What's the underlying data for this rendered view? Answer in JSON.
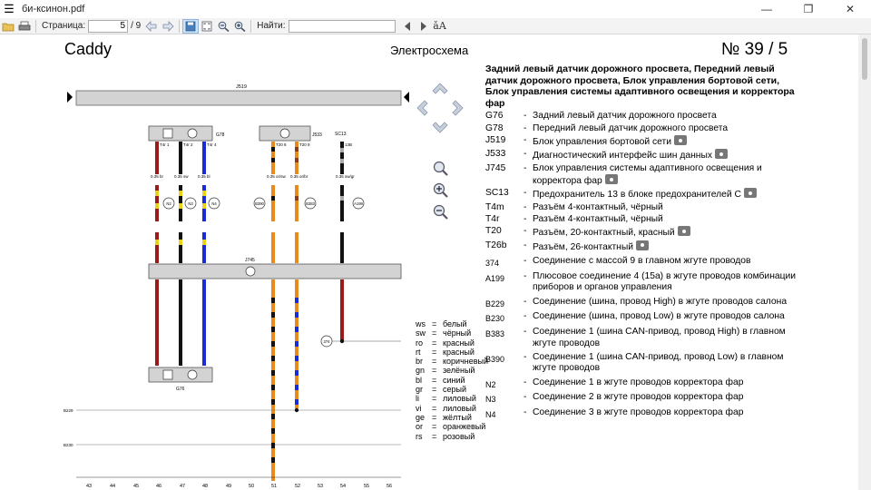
{
  "window": {
    "title": "би-ксинон.pdf",
    "buttons": [
      "—",
      "❐",
      "✕"
    ]
  },
  "toolbar": {
    "page_label": "Страница:",
    "page_value": "5",
    "page_total": "/ 9",
    "find_label": "Найти:",
    "find_value": ""
  },
  "doc": {
    "model": "Caddy",
    "section": "Электросхема",
    "number": "№  39 / 5"
  },
  "legend": {
    "heading": "Задний левый датчик дорожного просвета, Передний левый датчик дорожного просвета, Блок управления бортовой сети, Блок управления системы адаптивного освещения и корректора фар",
    "items": [
      {
        "code": "G76",
        "desc": "Задний левый датчик дорожного просвета",
        "cam": false
      },
      {
        "code": "G78",
        "desc": "Передний левый датчик дорожного просвета",
        "cam": false
      },
      {
        "code": "J519",
        "desc": "Блок управления бортовой сети",
        "cam": true
      },
      {
        "code": "J533",
        "desc": "Диагностический интерфейс шин данных",
        "cam": true
      },
      {
        "code": "J745",
        "desc": "Блок управления системы адаптивного освещения и корректора фар",
        "cam": true
      },
      {
        "code": "SC13",
        "desc": "Предохранитель 13 в блоке предохранителей С",
        "cam": true
      },
      {
        "code": "T4m",
        "desc": "Разъём 4-контактный, чёрный",
        "cam": false
      },
      {
        "code": "T4r",
        "desc": "Разъём 4-контактный, чёрный",
        "cam": false
      },
      {
        "code": "T20",
        "desc": "Разъём, 20-контактный, красный",
        "cam": true
      },
      {
        "code": "T26b",
        "desc": "Разъём, 26-контактный",
        "cam": true
      },
      {
        "code": "374",
        "desc": "Соединение с массой 9 в главном жгуте проводов",
        "cam": false
      },
      {
        "code": "A199",
        "desc": "Плюсовое соединение 4 (15a) в жгуте проводов комбинации приборов и органов управления",
        "cam": false
      },
      {
        "code": "B229",
        "desc": "Соединение (шина, провод High) в жгуте проводов салона",
        "cam": false
      },
      {
        "code": "B230",
        "desc": "Соединение (шина, провод Low) в жгуте проводов салона",
        "cam": false
      },
      {
        "code": "B383",
        "desc": "Соединение 1 (шина CAN-привод, провод High) в главном жгуте проводов",
        "cam": false
      },
      {
        "code": "B390",
        "desc": "Соединение 1 (шина CAN-привод, провод Low) в главном жгуте проводов",
        "cam": false
      },
      {
        "code": "N2",
        "desc": "Соединение 1 в жгуте проводов корректора фар",
        "cam": false
      },
      {
        "code": "N3",
        "desc": "Соединение 2 в жгуте проводов корректора фар",
        "cam": false
      },
      {
        "code": "N4",
        "desc": "Соединение 3 в жгуте проводов корректора фар",
        "cam": false
      }
    ]
  },
  "wire_colors": [
    {
      "abbr": "ws",
      "name": "белый"
    },
    {
      "abbr": "sw",
      "name": "чёрный"
    },
    {
      "abbr": "ro",
      "name": "красный"
    },
    {
      "abbr": "rt",
      "name": "красный"
    },
    {
      "abbr": "br",
      "name": "коричневый"
    },
    {
      "abbr": "gn",
      "name": "зелёный"
    },
    {
      "abbr": "bl",
      "name": "синий"
    },
    {
      "abbr": "gr",
      "name": "серый"
    },
    {
      "abbr": "li",
      "name": "лиловый"
    },
    {
      "abbr": "vi",
      "name": "лиловый"
    },
    {
      "abbr": "ge",
      "name": "жёлтый"
    },
    {
      "abbr": "or",
      "name": "оранжевый"
    },
    {
      "abbr": "rs",
      "name": "розовый"
    }
  ],
  "diagram": {
    "j519_label": "J519",
    "j533_label": "J533",
    "sc13_label": "SC13",
    "j745_label": "J745",
    "g78_label": "G78",
    "g76_label": "G76",
    "b229": "B229",
    "b230": "B230",
    "b390": "B390",
    "b383": "B383",
    "a199": "A199",
    "n2": "N2",
    "n3": "N3",
    "n4": "N4",
    "g374": "374",
    "wire_top": [
      "0.35 br",
      "0.35 sw",
      "0.35 bl",
      "0.35 or/sw",
      "0.35 or/br",
      "0.35 sw/gr"
    ],
    "pins_top": [
      "T4r 1",
      "T4r 2",
      "T4r 4",
      "T20 8",
      "T20 9",
      "13B"
    ],
    "grid": [
      "43",
      "44",
      "45",
      "46",
      "47",
      "48",
      "49",
      "50",
      "51",
      "52",
      "53",
      "54",
      "55",
      "56"
    ]
  }
}
